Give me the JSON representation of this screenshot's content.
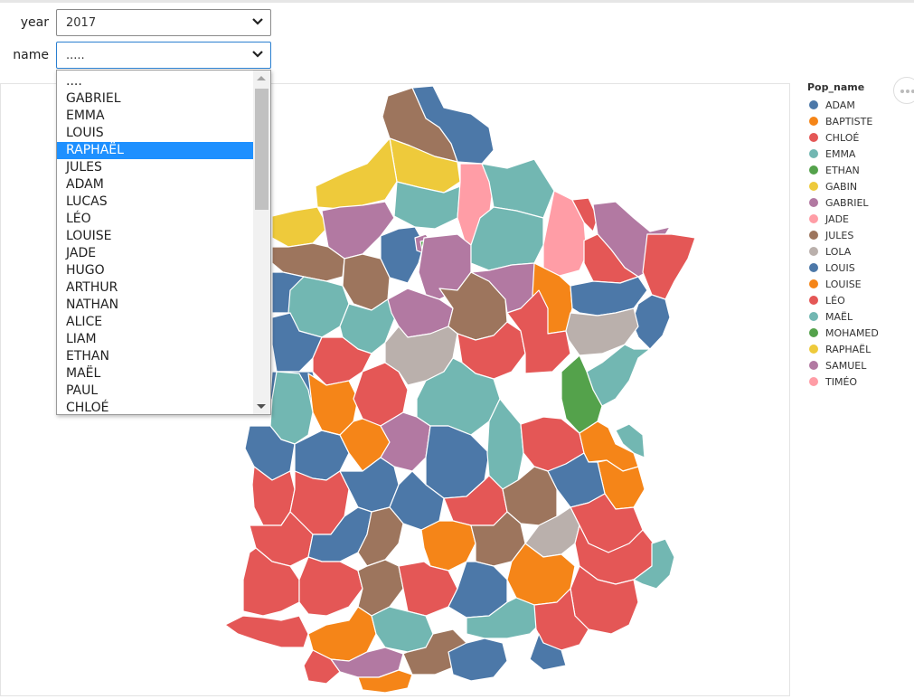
{
  "controls": {
    "year_label": "year",
    "year_value": "2017",
    "name_label": "name",
    "name_value": "....."
  },
  "dropdown": {
    "options": [
      "....",
      "GABRIEL",
      "EMMA",
      "LOUIS",
      "RAPHAËL",
      "JULES",
      "ADAM",
      "LUCAS",
      "LÉO",
      "LOUISE",
      "JADE",
      "HUGO",
      "ARTHUR",
      "NATHAN",
      "ALICE",
      "LIAM",
      "ETHAN",
      "MAËL",
      "PAUL",
      "CHLOÉ"
    ],
    "highlighted": "RAPHAËL"
  },
  "legend": {
    "title": "Pop_name",
    "items": [
      {
        "label": "ADAM",
        "color": "#4c78a8"
      },
      {
        "label": "BAPTISTE",
        "color": "#f58518"
      },
      {
        "label": "CHLOÉ",
        "color": "#e45756"
      },
      {
        "label": "EMMA",
        "color": "#72b7b2"
      },
      {
        "label": "ETHAN",
        "color": "#54a24b"
      },
      {
        "label": "GABIN",
        "color": "#eeca3b"
      },
      {
        "label": "GABRIEL",
        "color": "#b279a2"
      },
      {
        "label": "JADE",
        "color": "#ff9da6"
      },
      {
        "label": "JULES",
        "color": "#9d755d"
      },
      {
        "label": "LOLA",
        "color": "#bab0ac"
      },
      {
        "label": "LOUIS",
        "color": "#4c78a8"
      },
      {
        "label": "LOUISE",
        "color": "#f58518"
      },
      {
        "label": "LÉO",
        "color": "#e45756"
      },
      {
        "label": "MAËL",
        "color": "#72b7b2"
      },
      {
        "label": "MOHAMED",
        "color": "#54a24b"
      },
      {
        "label": "RAPHAËL",
        "color": "#eeca3b"
      },
      {
        "label": "SAMUEL",
        "color": "#b279a2"
      },
      {
        "label": "TIMÉO",
        "color": "#ff9da6"
      }
    ]
  },
  "map_regions": [
    {
      "name": "ADAM",
      "color": "#4c78a8"
    },
    {
      "name": "JULES",
      "color": "#9d755d"
    },
    {
      "name": "RAPHAËL",
      "color": "#eeca3b"
    },
    {
      "name": "EMMA",
      "color": "#72b7b2"
    },
    {
      "name": "TIMÉO",
      "color": "#ff9da6"
    },
    {
      "name": "GABRIEL",
      "color": "#b279a2"
    },
    {
      "name": "CHLOÉ",
      "color": "#e45756"
    },
    {
      "name": "BAPTISTE",
      "color": "#f58518"
    },
    {
      "name": "LOLA",
      "color": "#bab0ac"
    },
    {
      "name": "ETHAN",
      "color": "#54a24b"
    }
  ]
}
